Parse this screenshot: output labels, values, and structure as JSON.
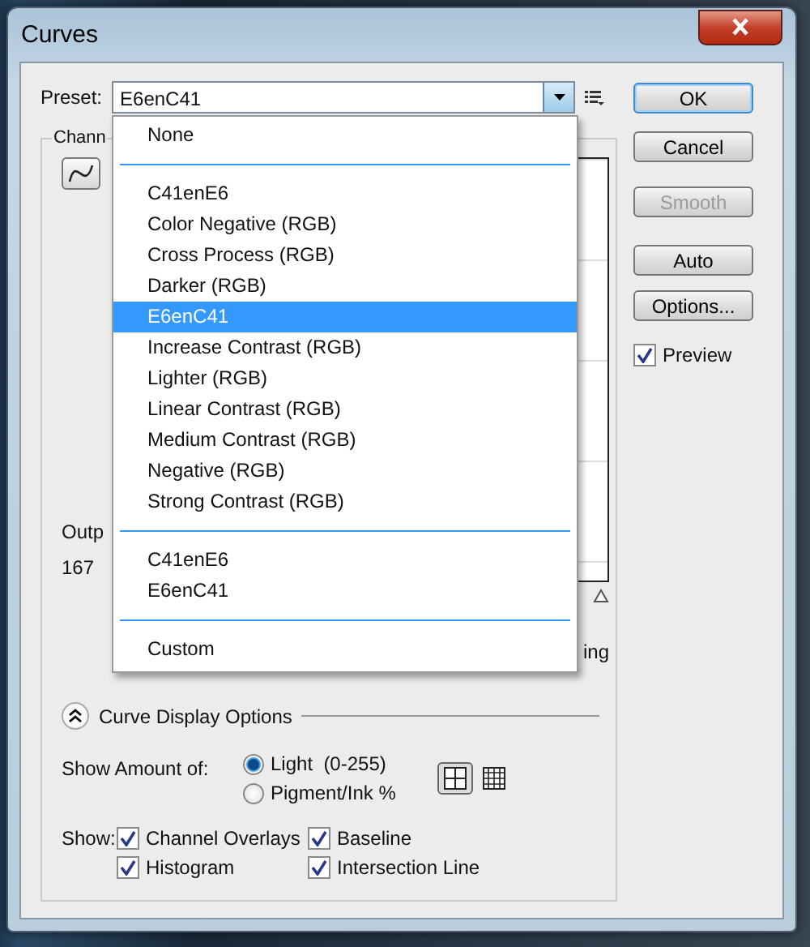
{
  "window": {
    "title": "Curves"
  },
  "preset": {
    "label": "Preset:",
    "value": "E6enC41"
  },
  "preset_menu": {
    "items": [
      {
        "kind": "item",
        "label": "None",
        "selected": false
      },
      {
        "kind": "separator"
      },
      {
        "kind": "item",
        "label": "C41enE6",
        "selected": false
      },
      {
        "kind": "item",
        "label": "Color Negative (RGB)",
        "selected": false
      },
      {
        "kind": "item",
        "label": "Cross Process (RGB)",
        "selected": false
      },
      {
        "kind": "item",
        "label": "Darker (RGB)",
        "selected": false
      },
      {
        "kind": "item",
        "label": "E6enC41",
        "selected": true
      },
      {
        "kind": "item",
        "label": "Increase Contrast (RGB)",
        "selected": false
      },
      {
        "kind": "item",
        "label": "Lighter (RGB)",
        "selected": false
      },
      {
        "kind": "item",
        "label": "Linear Contrast (RGB)",
        "selected": false
      },
      {
        "kind": "item",
        "label": "Medium Contrast (RGB)",
        "selected": false
      },
      {
        "kind": "item",
        "label": "Negative (RGB)",
        "selected": false
      },
      {
        "kind": "item",
        "label": "Strong Contrast (RGB)",
        "selected": false
      },
      {
        "kind": "separator"
      },
      {
        "kind": "item",
        "label": "C41enE6",
        "selected": false
      },
      {
        "kind": "item",
        "label": "E6enC41",
        "selected": false
      },
      {
        "kind": "separator"
      },
      {
        "kind": "item",
        "label": "Custom",
        "selected": false
      }
    ]
  },
  "buttons": [
    {
      "label": "OK",
      "default": true,
      "disabled": false
    },
    {
      "label": "Cancel",
      "default": false,
      "disabled": false
    },
    {
      "label": "Smooth",
      "default": false,
      "disabled": true
    },
    {
      "label": "Auto",
      "default": false,
      "disabled": false
    },
    {
      "label": "Options...",
      "default": false,
      "disabled": false
    }
  ],
  "preview": {
    "label": "Preview",
    "checked": true
  },
  "channel_group": {
    "legend": "Chann",
    "output_label": "Outp",
    "output_value": "167",
    "column_3": "ing"
  },
  "curve_display_options": {
    "title": "Curve Display Options",
    "expanded": true,
    "show_amount": {
      "label": "Show Amount of:",
      "options": [
        {
          "label": "Light  (0-255)",
          "selected": true
        },
        {
          "label": "Pigment/Ink %",
          "selected": false
        }
      ]
    },
    "grid": [
      {
        "selected": true
      },
      {
        "selected": false
      }
    ],
    "show": {
      "label": "Show:",
      "options": [
        {
          "label": "Channel Overlays",
          "checked": true
        },
        {
          "label": "Baseline",
          "checked": true
        },
        {
          "label": "Histogram",
          "checked": true
        },
        {
          "label": "Intersection Line",
          "checked": true
        }
      ]
    }
  }
}
